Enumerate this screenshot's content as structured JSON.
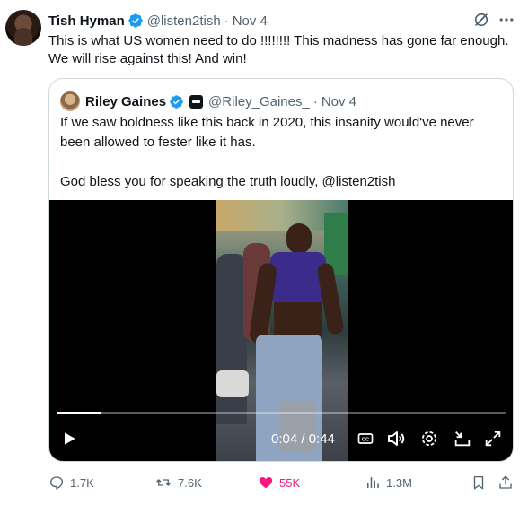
{
  "tweet": {
    "author_name": "Tish Hyman",
    "handle": "@listen2tish",
    "separator": "·",
    "date": "Nov 4",
    "text": "This is what US women need to do !!!!!!!! This madness has gone far enough.\nWe will rise against this! And win!"
  },
  "quote": {
    "author_name": "Riley Gaines",
    "handle": "@Riley_Gaines_",
    "separator": "·",
    "date": "Nov 4",
    "text": "If we saw boldness like this back in 2020, this insanity would've never\nbeen allowed to fester like it has.\n\nGod bless you for speaking the truth loudly, @listen2tish",
    "video": {
      "time": "0:04 / 0:44",
      "progress": 0.1
    }
  },
  "actions": {
    "replies": "1.7K",
    "reposts": "7.6K",
    "likes": "55K",
    "views": "1.3M"
  },
  "colors": {
    "verified": "#1d9bf0",
    "like": "#f91880",
    "muted": "#536471",
    "text": "#0f1419"
  },
  "icons": [
    "grok-icon",
    "more-icon",
    "verified-icon",
    "play-icon",
    "captions-icon",
    "volume-icon",
    "settings-icon",
    "exit-fullscreen-icon",
    "fullscreen-icon",
    "reply-icon",
    "repost-icon",
    "like-icon",
    "views-icon",
    "bookmark-icon",
    "share-icon"
  ]
}
